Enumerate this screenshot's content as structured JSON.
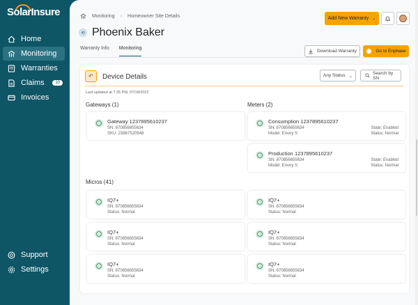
{
  "app": {
    "logo_text": "SolarInsure"
  },
  "sidebar": {
    "items": [
      {
        "label": "Home",
        "icon": "home-icon"
      },
      {
        "label": "Monitoring",
        "icon": "monitoring-icon",
        "active": true
      },
      {
        "label": "Warranties",
        "icon": "warranties-icon"
      },
      {
        "label": "Claims",
        "icon": "claims-icon",
        "badge": "10"
      },
      {
        "label": "Invoices",
        "icon": "invoices-icon"
      }
    ],
    "bottom_items": [
      {
        "label": "Support",
        "icon": "support-icon"
      },
      {
        "label": "Settings",
        "icon": "settings-icon"
      }
    ]
  },
  "header": {
    "breadcrumb": [
      "Monitoring",
      "Homeowner Site Details"
    ],
    "add_button": "Add New Warranty",
    "page_title": "Phoenix Baker"
  },
  "tabs": [
    {
      "label": "Warranty Info",
      "active": false
    },
    {
      "label": "Monitoring",
      "active": true
    }
  ],
  "actions": {
    "download": "Download Warranty",
    "enphase": "Go to Enphase"
  },
  "device_details": {
    "title": "Device Details",
    "status_filter": "Any Status",
    "search_placeholder": "Search by SN",
    "last_updated": "Last updated at 7:35 PM, 07/18/2022"
  },
  "gateways": {
    "title": "Gateways (1)",
    "items": [
      {
        "name": "Gateway 1237895610237",
        "line1": "SN: 870856655634",
        "line2": "SKU: 23867520948"
      }
    ]
  },
  "meters": {
    "title": "Meters (2)",
    "items": [
      {
        "name": "Consumption 1237895610237",
        "line1": "SN: 870856655634",
        "line2": "Model: Envoy S",
        "right1": "State: Enabled",
        "right2": "Status: Normal"
      },
      {
        "name": "Production 1237895610237",
        "line1": "SN: 870856655634",
        "line2": "Model: Envoy S",
        "right1": "State: Enabled",
        "right2": "Status: Normal"
      }
    ]
  },
  "micros": {
    "title": "Micros (41)",
    "items": [
      {
        "name": "IQ7+",
        "line1": "SN: 870856655634",
        "line2": "Status: Normal"
      },
      {
        "name": "IQ7+",
        "line1": "SN: 870856655634",
        "line2": "Status: Normal"
      },
      {
        "name": "IQ7+",
        "line1": "SN: 870856655634",
        "line2": "Status: Normal"
      },
      {
        "name": "IQ7+",
        "line1": "SN: 870856655634",
        "line2": "Status: Normal"
      },
      {
        "name": "IQ7+",
        "line1": "SN: 870856655634",
        "line2": "Status: Normal"
      },
      {
        "name": "IQ7+",
        "line1": "SN: 870856655634",
        "line2": "Status: Normal"
      }
    ]
  },
  "colors": {
    "sidebar": "#0e5566",
    "accent": "#f5a300",
    "ok": "#4d9a6b"
  }
}
